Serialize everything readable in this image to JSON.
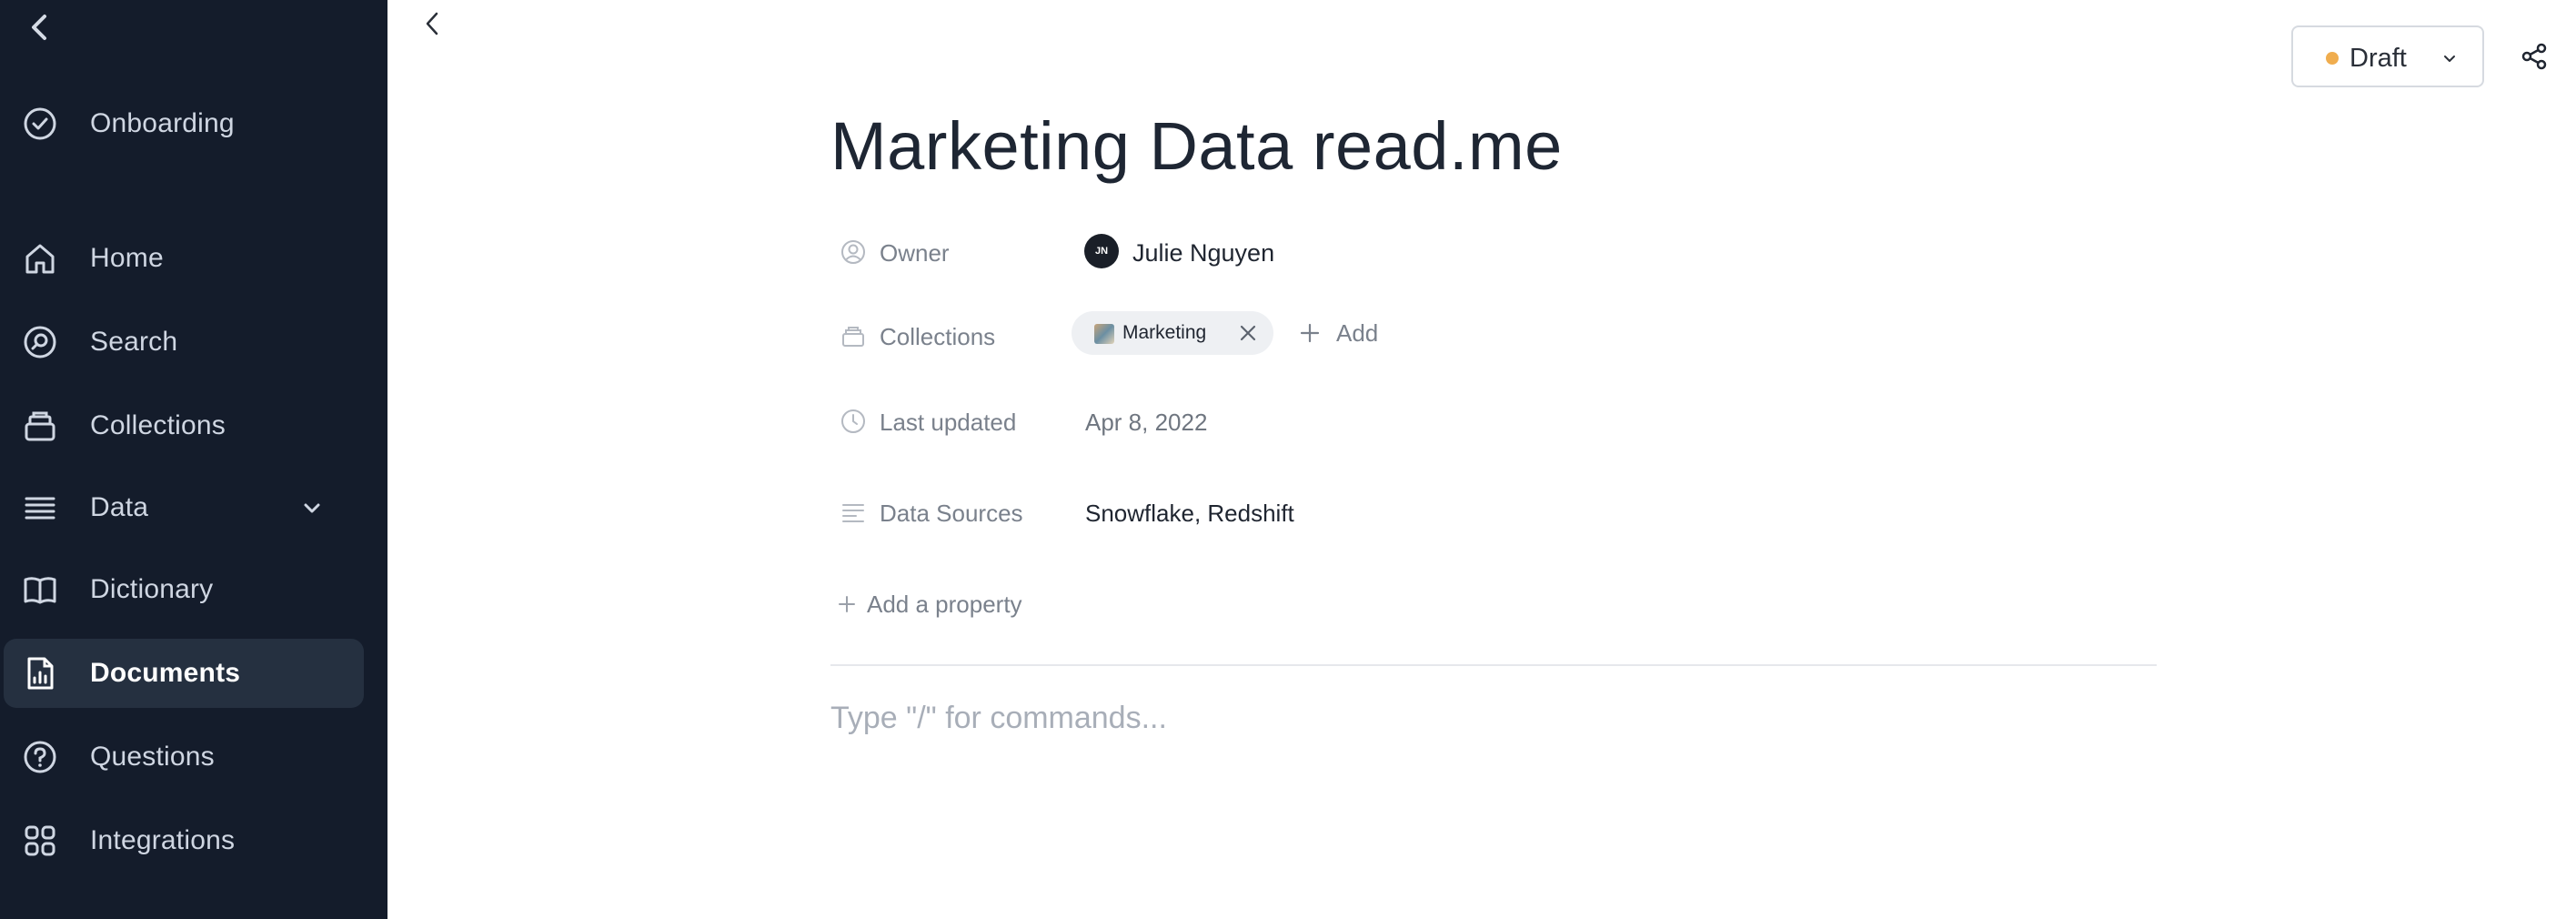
{
  "sidebar": {
    "collapse_icon": "chevron-left-icon",
    "items": [
      {
        "label": "Onboarding",
        "icon": "check-circle-icon"
      },
      {
        "label": "Home",
        "icon": "home-icon"
      },
      {
        "label": "Search",
        "icon": "search-icon"
      },
      {
        "label": "Collections",
        "icon": "collections-icon"
      },
      {
        "label": "Data",
        "icon": "data-list-icon"
      },
      {
        "label": "Dictionary",
        "icon": "book-icon"
      },
      {
        "label": "Documents",
        "icon": "document-chart-icon"
      },
      {
        "label": "Questions",
        "icon": "question-circle-icon"
      },
      {
        "label": "Integrations",
        "icon": "grid-icon"
      }
    ],
    "active": "Documents"
  },
  "header": {
    "status": {
      "label": "Draft",
      "dot_color": "#f0ad4e"
    }
  },
  "document": {
    "title": "Marketing Data read.me",
    "properties": {
      "owner": {
        "label": "Owner",
        "initials": "JN",
        "name": "Julie Nguyen"
      },
      "collections": {
        "label": "Collections",
        "chip": "Marketing",
        "add_label": "Add"
      },
      "last_updated": {
        "label": "Last updated",
        "value": "Apr 8, 2022"
      },
      "data_sources": {
        "label": "Data Sources",
        "value": "Snowflake, Redshift"
      }
    },
    "add_property_label": "Add a property",
    "editor_placeholder": "Type \"/\" for commands..."
  },
  "colors": {
    "sidebar_bg": "#141c2b",
    "sidebar_active": "#253040",
    "title": "#1e2633",
    "muted": "#7a818c"
  }
}
